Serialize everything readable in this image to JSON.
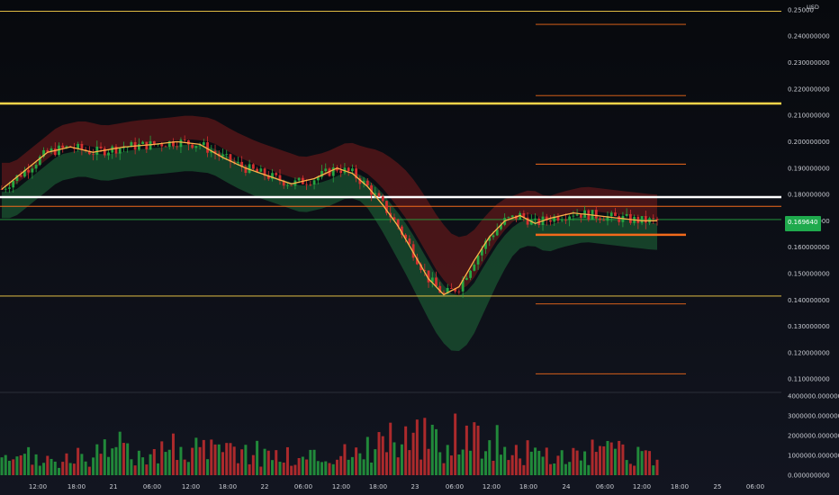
{
  "currency": "USD",
  "price_badge": {
    "value": "0.169640",
    "bg_color": "#1faa4d"
  },
  "colors": {
    "bullish": "#26a641",
    "bearish": "#d32f2f",
    "moving_average": "#ffb24a",
    "white_level": "#ffffff",
    "yellow_level": "#ffd54a",
    "orange_level": "#f26a1b",
    "band_green": "#1f6b3a",
    "band_red": "#7a1c1c"
  },
  "chart_data": [
    {
      "type": "candlestick",
      "title": "",
      "y_axis_labels": [
        "0.25000",
        "0.240000000",
        "0.230000000",
        "0.220000000",
        "0.210000000",
        "0.200000000",
        "0.190000000",
        "0.180000000",
        "0.170000000",
        "0.160000000",
        "0.150000000",
        "0.140000000",
        "0.130000000",
        "0.120000000",
        "0.110000000"
      ],
      "ylim": [
        0.107,
        0.251
      ],
      "x_axis_labels": [
        "12:00",
        "18:00",
        "21",
        "06:00",
        "12:00",
        "18:00",
        "22",
        "06:00",
        "12:00",
        "18:00",
        "23",
        "06:00",
        "12:00",
        "18:00",
        "24",
        "06:00",
        "12:00",
        "18:00",
        "25",
        "06:00"
      ],
      "last_price": 0.16964,
      "trend_path": [
        [
          0,
          0.182
        ],
        [
          6,
          0.189
        ],
        [
          12,
          0.196
        ],
        [
          18,
          0.198
        ],
        [
          24,
          0.196
        ],
        [
          32,
          0.198
        ],
        [
          40,
          0.199
        ],
        [
          46,
          0.2
        ],
        [
          52,
          0.199
        ],
        [
          58,
          0.194
        ],
        [
          64,
          0.19
        ],
        [
          70,
          0.187
        ],
        [
          76,
          0.184
        ],
        [
          82,
          0.186
        ],
        [
          88,
          0.19
        ],
        [
          92,
          0.188
        ],
        [
          96,
          0.183
        ],
        [
          100,
          0.176
        ],
        [
          104,
          0.168
        ],
        [
          108,
          0.158
        ],
        [
          112,
          0.148
        ],
        [
          116,
          0.142
        ],
        [
          120,
          0.145
        ],
        [
          124,
          0.155
        ],
        [
          128,
          0.164
        ],
        [
          132,
          0.17
        ],
        [
          136,
          0.172
        ],
        [
          140,
          0.169
        ],
        [
          144,
          0.171
        ],
        [
          150,
          0.173
        ],
        [
          156,
          0.172
        ],
        [
          162,
          0.171
        ],
        [
          168,
          0.17
        ],
        [
          172,
          0.17
        ]
      ],
      "horizontal_levels": [
        {
          "price": 0.2145,
          "color": "white_level_yellow",
          "full_width": true,
          "weight": "thick"
        },
        {
          "price": 0.179,
          "color": "white",
          "full_width": true,
          "weight": "thick"
        },
        {
          "price": 0.1755,
          "color": "orange",
          "full_width": true,
          "weight": "thin"
        },
        {
          "price": 0.1705,
          "color": "green",
          "full_width": true,
          "weight": "thin"
        },
        {
          "price": 0.1415,
          "color": "yellow",
          "full_width": true,
          "weight": "thin"
        },
        {
          "price": 0.2495,
          "color": "yellow",
          "full_width": true,
          "weight": "thin"
        },
        {
          "price": 0.1647,
          "color": "orange",
          "full_width": false,
          "weight": "thick"
        },
        {
          "price": 0.2445,
          "color": "orange",
          "full_width": false,
          "weight": "thin"
        },
        {
          "price": 0.2175,
          "color": "orange",
          "full_width": false,
          "weight": "thin"
        },
        {
          "price": 0.1915,
          "color": "orange",
          "full_width": false,
          "weight": "thin"
        },
        {
          "price": 0.1385,
          "color": "orange",
          "full_width": false,
          "weight": "thin"
        },
        {
          "price": 0.112,
          "color": "orange",
          "full_width": false,
          "weight": "thin"
        }
      ]
    },
    {
      "type": "bar",
      "title": "",
      "y_axis_labels": [
        "4000000.000000000",
        "3000000.000000000",
        "2000000.000000000",
        "1000000.000000000",
        "0.000000000"
      ],
      "ylim": [
        0,
        4000000
      ],
      "volume_profile": [
        [
          0,
          0.6
        ],
        [
          8,
          0.9
        ],
        [
          16,
          0.7
        ],
        [
          24,
          1.0
        ],
        [
          32,
          1.4
        ],
        [
          40,
          1.2
        ],
        [
          48,
          1.5
        ],
        [
          56,
          1.1
        ],
        [
          64,
          1.3
        ],
        [
          72,
          1.0
        ],
        [
          80,
          0.9
        ],
        [
          88,
          1.0
        ],
        [
          96,
          1.4
        ],
        [
          104,
          2.0
        ],
        [
          110,
          1.8
        ],
        [
          116,
          1.6
        ],
        [
          120,
          2.4
        ],
        [
          124,
          2.0
        ],
        [
          128,
          1.8
        ],
        [
          134,
          1.3
        ],
        [
          140,
          1.0
        ],
        [
          146,
          0.9
        ],
        [
          152,
          1.0
        ],
        [
          158,
          1.2
        ],
        [
          164,
          1.0
        ],
        [
          172,
          0.7
        ]
      ]
    }
  ]
}
